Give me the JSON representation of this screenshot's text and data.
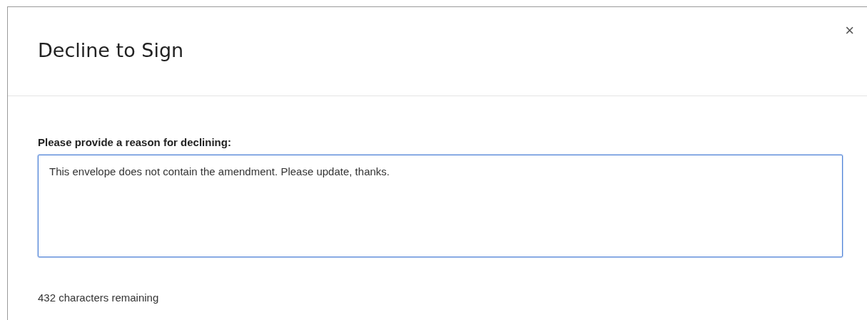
{
  "dialog": {
    "title": "Decline to Sign",
    "close": "×"
  },
  "reason_field": {
    "label": "Please provide a reason for declining:",
    "value": "This envelope does not contain the amendment. Please update, thanks.",
    "focused": true
  },
  "counter": "432 characters remaining"
}
